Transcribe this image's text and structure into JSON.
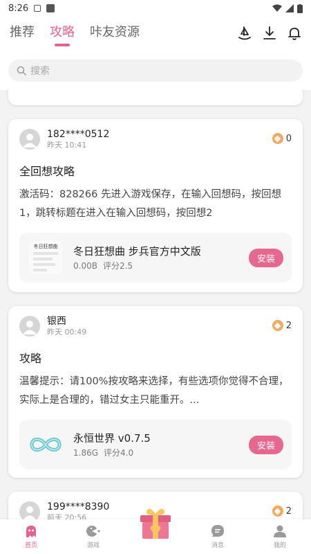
{
  "status": {
    "time": "8:26"
  },
  "nav": {
    "tabs": [
      {
        "label": "推荐"
      },
      {
        "label": "攻略"
      },
      {
        "label": "咔友资源"
      }
    ]
  },
  "search": {
    "placeholder": "搜索"
  },
  "posts": [
    {
      "user": "182****0512",
      "time": "昨天 10:41",
      "coins": "0",
      "title": "全回想攻略",
      "body": "激活码：828266 先进入游戏保存，在输入回想码，按回想1，跳转标题在进入在输入回想码，按回想2",
      "app": {
        "name": "冬日狂想曲 步兵官方中文版",
        "size": "0.00B",
        "rating": "评分2.5",
        "icon_text": "冬日狂想曲",
        "install": "安装"
      }
    },
    {
      "user": "银西",
      "time": "昨天 00:49",
      "coins": "2",
      "title": "攻略",
      "body": "温馨提示：请100%按攻略来选择，有些选项你觉得不合理，实际上是合理的，错过女主只能重开。...",
      "app": {
        "name": "永恒世界 v0.7.5",
        "size": "1.86G",
        "rating": "评分4.0",
        "install": "安装"
      }
    },
    {
      "user": "199****8390",
      "time": "前天 20:56",
      "coins": "2"
    }
  ],
  "bottom_nav": [
    {
      "label": "首页"
    },
    {
      "label": "游戏"
    },
    {
      "label": ""
    },
    {
      "label": "消息"
    },
    {
      "label": "我的"
    }
  ],
  "colors": {
    "accent": "#e7628b",
    "coin": "#f4a95b"
  }
}
